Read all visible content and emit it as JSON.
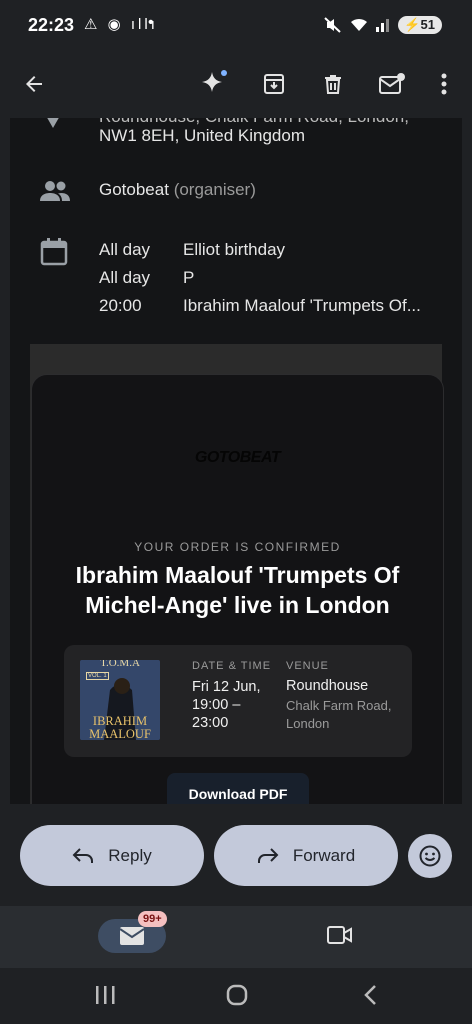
{
  "status_bar": {
    "time": "22:23",
    "left_icons": "⚠ ◉ ıllı",
    "dot": "•",
    "battery": "51"
  },
  "toolbar": {
    "back_icon": "arrow-left-icon",
    "actions": [
      "sparkle-icon",
      "archive-icon",
      "trash-icon",
      "mark-unread-icon",
      "more-vert-icon"
    ]
  },
  "event": {
    "location_partial": "Roundhouse, Chalk Farm Road, London,",
    "location_line2": "NW1 8EH, United Kingdom",
    "organiser_name": "Gotobeat",
    "organiser_role": "(organiser)",
    "calendar": [
      {
        "when": "All day",
        "what": "Elliot birthday"
      },
      {
        "when": "All day",
        "what": "P"
      },
      {
        "when": "20:00",
        "what": "Ibrahim Maalouf 'Trumpets Of..."
      }
    ]
  },
  "card": {
    "logo": "GOTOBEAT",
    "confirm_label": "YOUR ORDER IS CONFIRMED",
    "title": "Ibrahim Maalouf 'Trumpets Of Michel-Ange' live in London",
    "poster_top": "T.O.M.A",
    "poster_vol": "VOL. 1",
    "poster_name": "IBRAHIM MAALOUF",
    "date_label": "DATE & TIME",
    "date_value": "Fri 12 Jun, 19:00 – 23:00",
    "venue_label": "VENUE",
    "venue_name": "Roundhouse",
    "venue_address": "Chalk Farm Road, London",
    "download_label": "Download PDF"
  },
  "actions": {
    "reply": "Reply",
    "forward": "Forward"
  },
  "bottom_nav": {
    "mail_badge": "99+"
  },
  "colors": {
    "background": "#1f2124",
    "content": "#141517",
    "pill": "#c3c9da",
    "accent_dot": "#7fb3ff"
  }
}
